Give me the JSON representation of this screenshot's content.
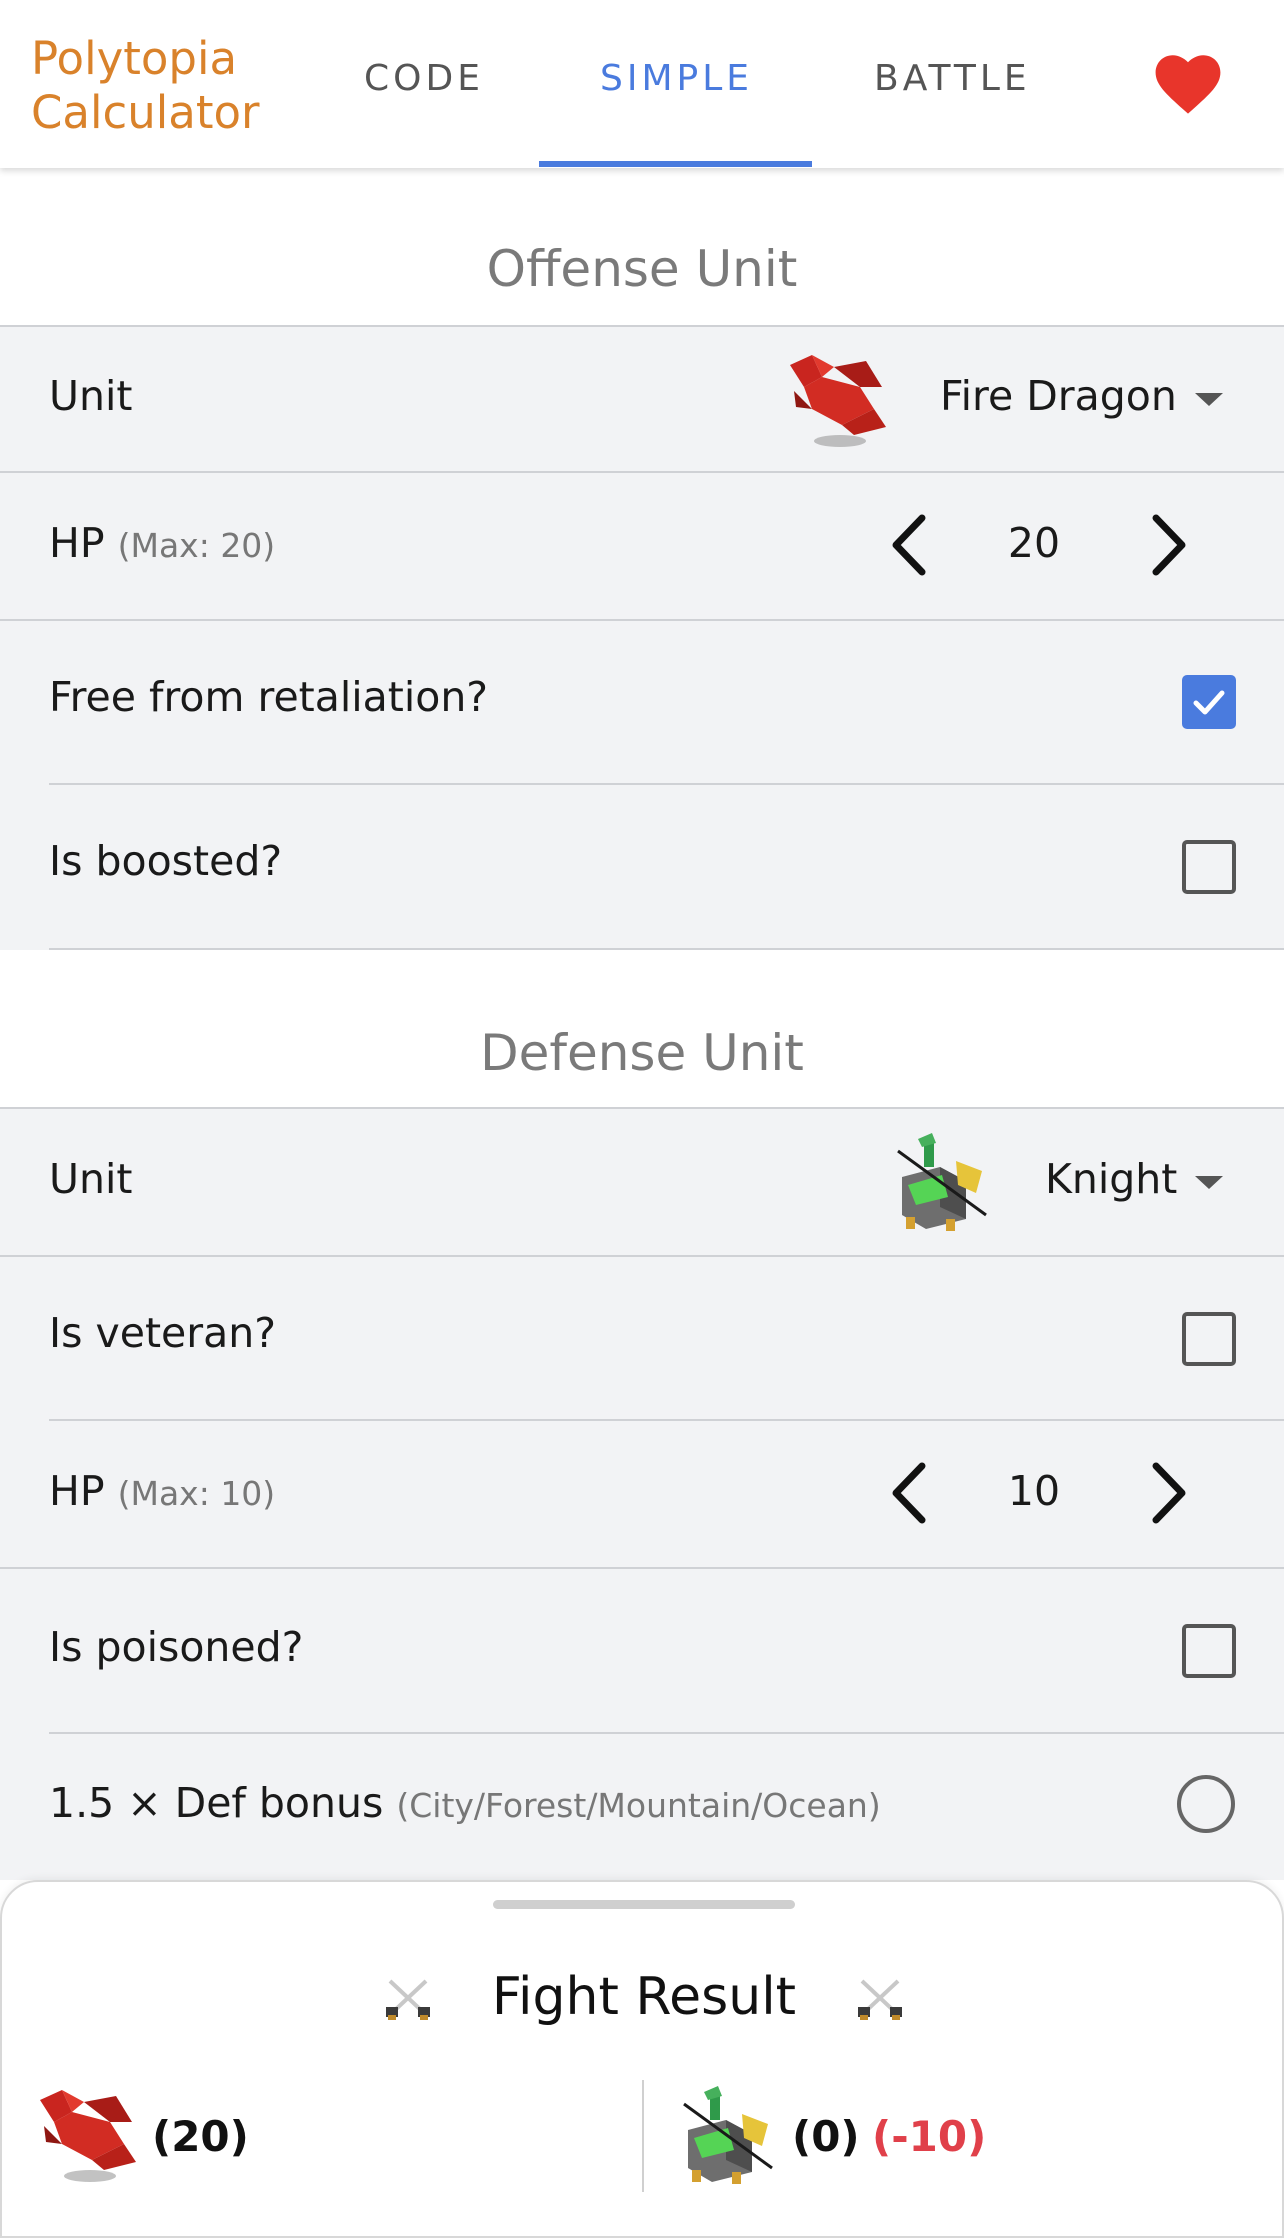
{
  "header": {
    "logo_line1": "Polytopia",
    "logo_line2": "Calculator",
    "tabs": [
      {
        "label": "CODE"
      },
      {
        "label": "SIMPLE"
      },
      {
        "label": "BATTLE"
      }
    ],
    "active_tab": "SIMPLE",
    "accent_color": "#4a7bde",
    "brand_color": "#d9822b"
  },
  "offense": {
    "title": "Offense Unit",
    "unit_label": "Unit",
    "unit_value": "Fire Dragon",
    "hp_label": "HP",
    "hp_max": "(Max: 20)",
    "hp_value": "20",
    "retaliation_label": "Free from retaliation?",
    "retaliation_checked": true,
    "boosted_label": "Is boosted?",
    "boosted_checked": false
  },
  "defense": {
    "title": "Defense Unit",
    "unit_label": "Unit",
    "unit_value": "Knight",
    "veteran_label": "Is veteran?",
    "veteran_checked": false,
    "hp_label": "HP",
    "hp_max": "(Max: 10)",
    "hp_value": "10",
    "poisoned_label": "Is poisoned?",
    "poisoned_checked": false,
    "defbonus_label": "1.5 × Def bonus",
    "defbonus_hint": "(City/Forest/Mountain/Ocean)",
    "defbonus_selected": false
  },
  "result": {
    "title": "Fight Result",
    "offense_hp": "(20)",
    "defense_hp": "(0)",
    "defense_delta": "(-10)",
    "loss_color": "#e0404a"
  }
}
